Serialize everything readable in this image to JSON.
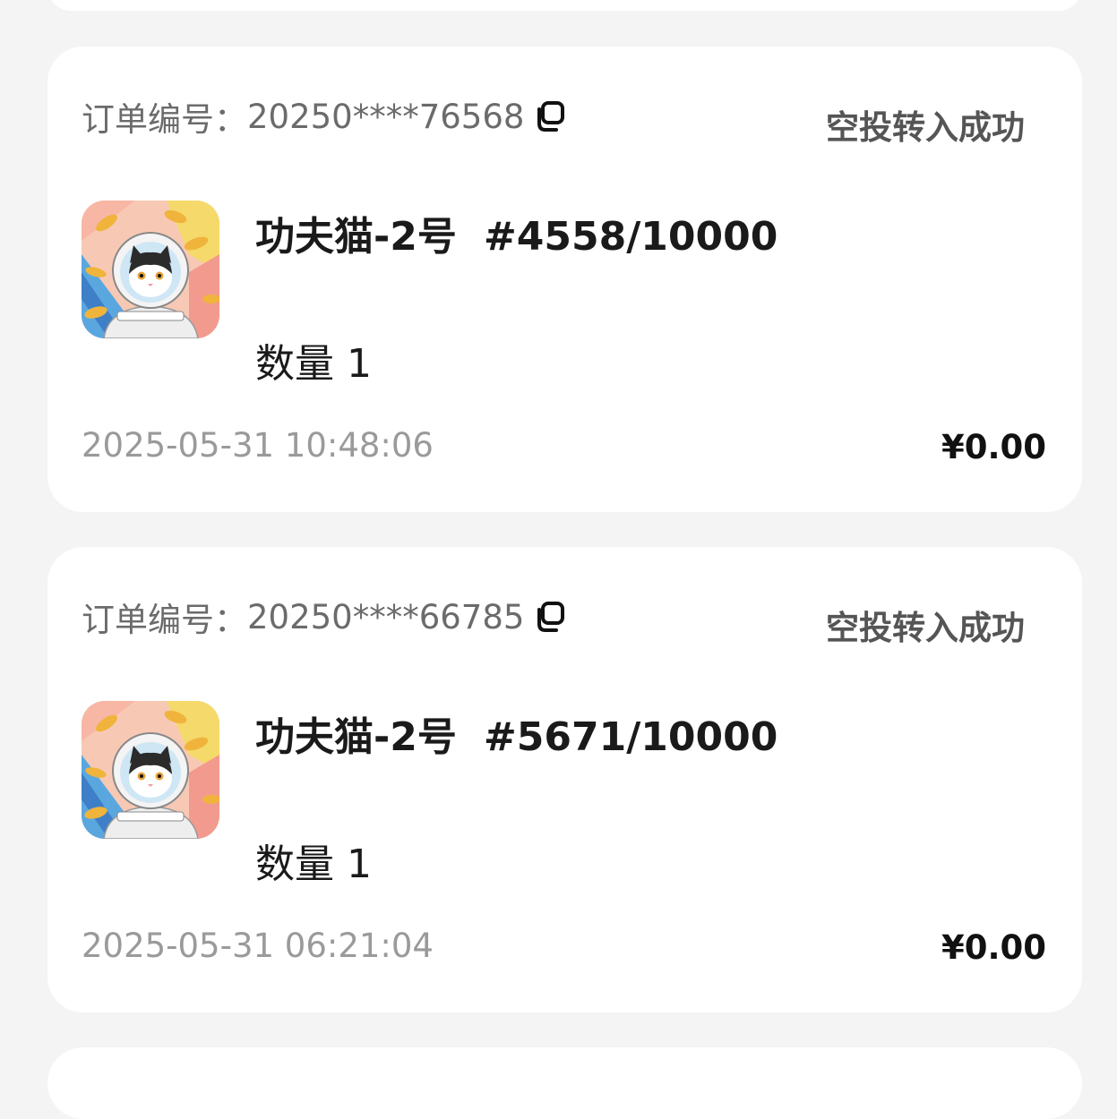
{
  "orders": [
    {
      "order_label": "订单编号：",
      "order_no": "20250****76568",
      "status": "空投转入成功",
      "product_name": "功夫猫-2号",
      "serial": "#4558/10000",
      "qty_label": "数量",
      "qty": "1",
      "time": "2025-05-31 10:48:06",
      "price": "¥0.00"
    },
    {
      "order_label": "订单编号：",
      "order_no": "20250****66785",
      "status": "空投转入成功",
      "product_name": "功夫猫-2号",
      "serial": "#5671/10000",
      "qty_label": "数量",
      "qty": "1",
      "time": "2025-05-31 06:21:04",
      "price": "¥0.00"
    }
  ],
  "icons": {
    "copy": "copy-icon",
    "thumbnail": "astronaut-cat-image"
  }
}
